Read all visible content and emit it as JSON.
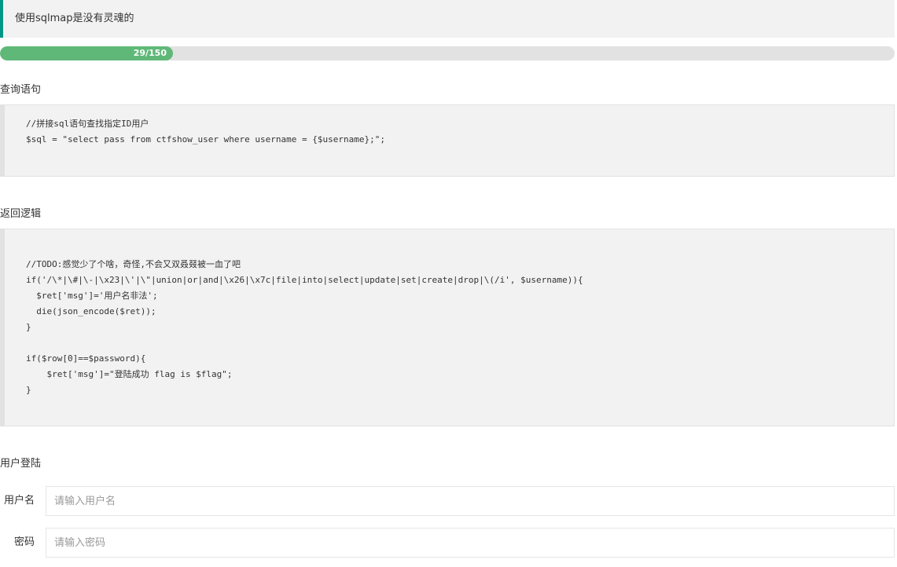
{
  "notice": {
    "text": "使用sqlmap是没有灵魂的"
  },
  "progress": {
    "label": "29/150",
    "current": 29,
    "total": 150,
    "color": "#5fb878"
  },
  "query_section": {
    "title": "查询语句",
    "lines": [
      "//拼接sql语句查找指定ID用户",
      "$sql = \"select pass from ctfshow_user where username = {$username};\";"
    ]
  },
  "logic_section": {
    "title": "返回逻辑",
    "lines": [
      "",
      "//TODO:感觉少了个啥，奇怪,不会又双叒叕被一血了吧",
      "if('/\\*|\\#|\\-|\\x23|\\'|\\\"|union|or|and|\\x26|\\x7c|file|into|select|update|set|create|drop|\\(/i', $username)){",
      "  $ret['msg']='用户名非法';",
      "  die(json_encode($ret));",
      "}",
      "",
      "if($row[0]==$password){",
      "    $ret['msg']=\"登陆成功 flag is $flag\";",
      "}"
    ]
  },
  "login": {
    "title": "用户登陆",
    "username_label": "用户名",
    "username_placeholder": "请输入用户名",
    "password_label": "密码",
    "password_placeholder": "请输入密码"
  },
  "colors": {
    "accent": "#009688",
    "progress": "#5fb878"
  }
}
